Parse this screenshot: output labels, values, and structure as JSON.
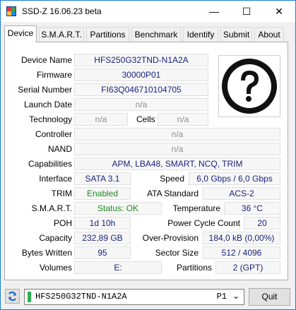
{
  "window": {
    "title": "SSD-Z 16.06.23 beta",
    "minimize": "—",
    "maximize": "☐",
    "close": "✕"
  },
  "tabs": [
    "Device",
    "S.M.A.R.T.",
    "Partitions",
    "Benchmark",
    "Identify",
    "Submit",
    "About"
  ],
  "device": {
    "device_name_label": "Device Name",
    "device_name": "HFS250G32TND-N1A2A",
    "firmware_label": "Firmware",
    "firmware": "30000P01",
    "serial_label": "Serial Number",
    "serial": "FI63Q046710104705",
    "launch_date_label": "Launch Date",
    "launch_date": "n/a",
    "technology_label": "Technology",
    "technology": "n/a",
    "cells_label": "Cells",
    "cells": "n/a",
    "controller_label": "Controller",
    "controller": "n/a",
    "nand_label": "NAND",
    "nand": "n/a",
    "capabilities_label": "Capabilities",
    "capabilities": "APM, LBA48, SMART, NCQ, TRIM",
    "interface_label": "Interface",
    "interface": "SATA 3.1",
    "speed_label": "Speed",
    "speed": "6,0 Gbps / 6,0 Gbps",
    "trim_label": "TRIM",
    "trim": "Enabled",
    "ata_standard_label": "ATA Standard",
    "ata_standard": "ACS-2",
    "smart_label": "S.M.A.R.T.",
    "smart": "Status: OK",
    "temperature_label": "Temperature",
    "temperature": "36 °C",
    "poh_label": "POH",
    "poh": "1d 10h",
    "power_cycle_label": "Power Cycle Count",
    "power_cycle": "20",
    "capacity_label": "Capacity",
    "capacity": "232,89 GB",
    "over_provision_label": "Over-Provision",
    "over_provision": "184,0 kB (0,00%)",
    "bytes_written_label": "Bytes Written",
    "bytes_written": "95",
    "sector_size_label": "Sector Size",
    "sector_size": "512 / 4096",
    "volumes_label": "Volumes",
    "volumes": "E:",
    "partitions_label": "Partitions",
    "partitions": "2 (GPT)"
  },
  "footer": {
    "drive": "HFS250G32TND-N1A2A",
    "port": "P1",
    "quit_label": "Quit"
  },
  "icons": {
    "unknown_device": "question-mark-icon",
    "refresh": "refresh-icon",
    "app": "app-icon"
  },
  "colors": {
    "value_text": "#1a237e",
    "ok_text": "#1e8a1e",
    "na_text": "#8d8d8d",
    "titlebar_border": "#1a7fd4"
  }
}
